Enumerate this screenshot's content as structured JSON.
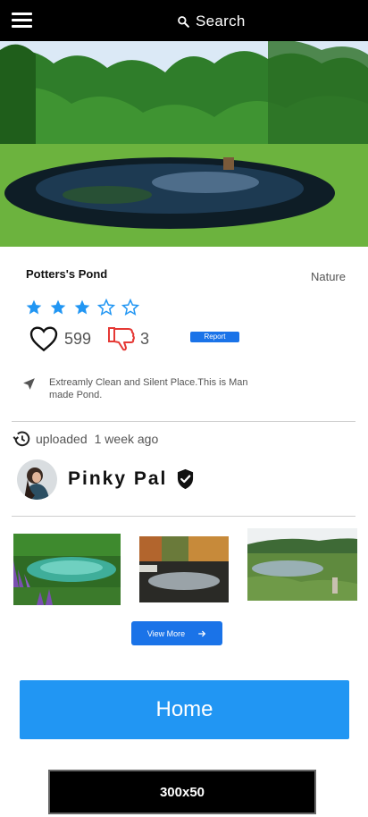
{
  "header": {
    "search_label": "Search",
    "menu_icon": "hamburger-menu-icon",
    "search_icon": "search-icon"
  },
  "place": {
    "title": "Potters's Pond",
    "category": "Nature",
    "rating": 3,
    "rating_max": 5,
    "likes": "599",
    "dislikes": "3",
    "report_label": "Report",
    "description": "Extreamly Clean and Silent Place.This is Man made Pond."
  },
  "upload": {
    "label": "uploaded",
    "time": "1 week ago"
  },
  "user": {
    "name": "Pinky Pal",
    "verified": true
  },
  "gallery": {
    "view_more_label": "View More"
  },
  "home_button": {
    "label": "Home"
  },
  "ad_banner": {
    "label": "300x50"
  },
  "colors": {
    "accent": "#1a73e8",
    "home": "#2196f3",
    "star": "#2196f3",
    "dislike": "#e53935",
    "topbar": "#000000"
  }
}
